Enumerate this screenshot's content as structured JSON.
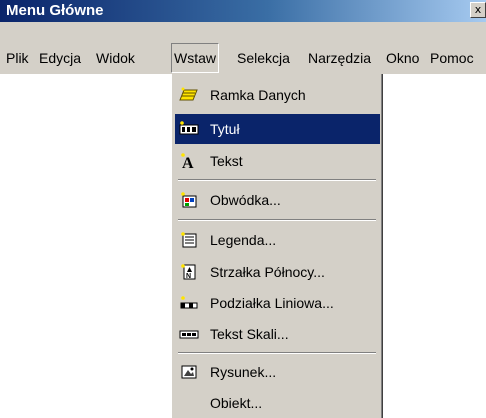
{
  "window": {
    "title": "Menu Główne",
    "close_glyph": "x"
  },
  "menubar": {
    "items": [
      {
        "label": "Plik",
        "mnemonic": "P"
      },
      {
        "label": "Edycja",
        "mnemonic": "E"
      },
      {
        "label": "Widok",
        "mnemonic": "W"
      },
      {
        "label": "Wstaw",
        "mnemonic": "t",
        "active": true
      },
      {
        "label": "Selekcja",
        "mnemonic": "S"
      },
      {
        "label": "Narzędzia",
        "mnemonic": "N"
      },
      {
        "label": "Okno",
        "mnemonic": "O"
      },
      {
        "label": "Pomoc",
        "mnemonic": "m"
      }
    ]
  },
  "dropdown": {
    "items": [
      {
        "label": "Ramka Danych",
        "icon": "data-frame-icon"
      },
      {
        "label": "Tytuł",
        "icon": "title-icon",
        "selected": true
      },
      {
        "label": "Tekst",
        "icon": "text-icon"
      },
      {
        "label": "Obwódka...",
        "icon": "border-icon"
      },
      {
        "label": "Legenda...",
        "icon": "legend-icon"
      },
      {
        "label": "Strzałka Północy...",
        "icon": "north-arrow-icon"
      },
      {
        "label": "Podziałka Liniowa...",
        "icon": "scale-bar-icon"
      },
      {
        "label": "Tekst Skali...",
        "icon": "scale-text-icon"
      },
      {
        "label": "Rysunek...",
        "icon": "picture-icon"
      },
      {
        "label": "Obiekt...",
        "icon": "object-icon"
      }
    ]
  },
  "colors": {
    "selection": "#0a246a",
    "menu_face": "#d4d0c8",
    "title_active": "#0a246a"
  }
}
